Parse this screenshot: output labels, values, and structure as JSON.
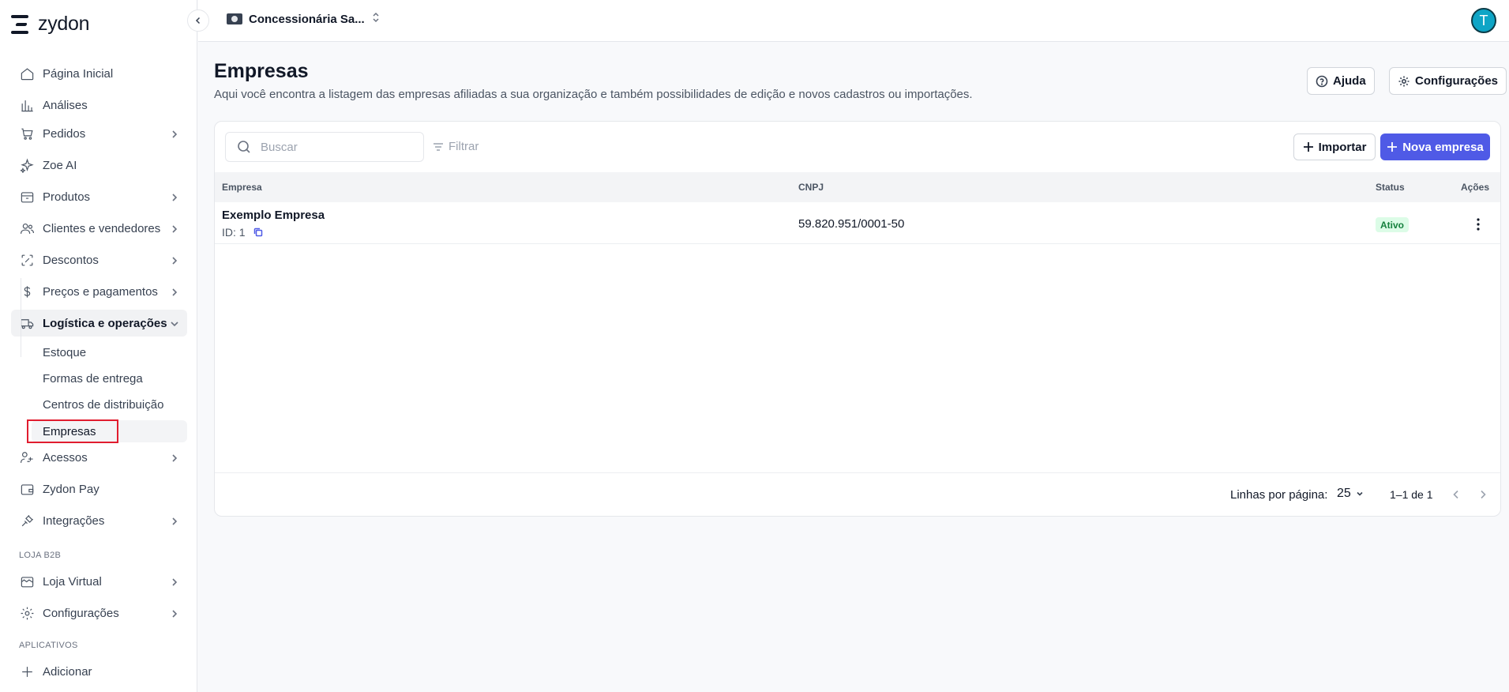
{
  "app": {
    "logo_text": "zydon"
  },
  "topbar": {
    "org_name": "Concessionária Sa...",
    "avatar_initial": "T"
  },
  "sidebar": {
    "items": [
      {
        "label": "Página Inicial",
        "icon": "home-icon",
        "has_chevron": false
      },
      {
        "label": "Análises",
        "icon": "bar-chart-icon",
        "has_chevron": false
      },
      {
        "label": "Pedidos",
        "icon": "cart-icon",
        "has_chevron": true
      },
      {
        "label": "Zoe AI",
        "icon": "sparkles-icon",
        "has_chevron": false
      },
      {
        "label": "Produtos",
        "icon": "box-icon",
        "has_chevron": true
      },
      {
        "label": "Clientes e vendedores",
        "icon": "users-icon",
        "has_chevron": true
      },
      {
        "label": "Descontos",
        "icon": "discount-icon",
        "has_chevron": true
      },
      {
        "label": "Preços e pagamentos",
        "icon": "dollar-icon",
        "has_chevron": true
      },
      {
        "label": "Logística e operações",
        "icon": "truck-icon",
        "has_chevron": true,
        "expanded": true
      }
    ],
    "subitems": [
      {
        "label": "Estoque"
      },
      {
        "label": "Formas de entrega"
      },
      {
        "label": "Centros de distribuição"
      },
      {
        "label": "Empresas",
        "current": true
      }
    ],
    "items_after": [
      {
        "label": "Acessos",
        "icon": "key-user-icon",
        "has_chevron": true
      },
      {
        "label": "Zydon Pay",
        "icon": "wallet-icon",
        "has_chevron": false
      },
      {
        "label": "Integrações",
        "icon": "plug-icon",
        "has_chevron": true
      }
    ],
    "section_b2b": "LOJA B2B",
    "b2b_items": [
      {
        "label": "Loja Virtual",
        "icon": "storefront-icon",
        "has_chevron": true
      },
      {
        "label": "Configurações",
        "icon": "gear-icon",
        "has_chevron": true
      }
    ],
    "section_apps": "APLICATIVOS",
    "apps_items": [
      {
        "label": "Adicionar",
        "icon": "plus-icon"
      }
    ]
  },
  "header": {
    "title": "Empresas",
    "subtitle": "Aqui você encontra a listagem das empresas afiliadas a sua organização e também possibilidades de edição e novos cadastros ou importações.",
    "help_label": "Ajuda",
    "settings_label": "Configurações"
  },
  "toolbar": {
    "search_placeholder": "Buscar",
    "search_value": "",
    "filter_label": "Filtrar",
    "import_label": "Importar",
    "new_label": "Nova empresa"
  },
  "table": {
    "columns": {
      "empresa": "Empresa",
      "cnpj": "CNPJ",
      "status": "Status",
      "acoes": "Ações"
    },
    "rows": [
      {
        "name": "Exemplo Empresa",
        "id_text": "ID: 1",
        "cnpj": "59.820.951/0001-50",
        "status": "Ativo"
      }
    ]
  },
  "pagination": {
    "rows_per_page_label": "Linhas por página:",
    "rows_per_page": "25",
    "range": "1–1 de 1"
  },
  "colors": {
    "accent": "#4f5ae6",
    "status_active_bg": "#dcfce7",
    "status_active_text": "#15803d",
    "highlight": "#e11d2f"
  }
}
